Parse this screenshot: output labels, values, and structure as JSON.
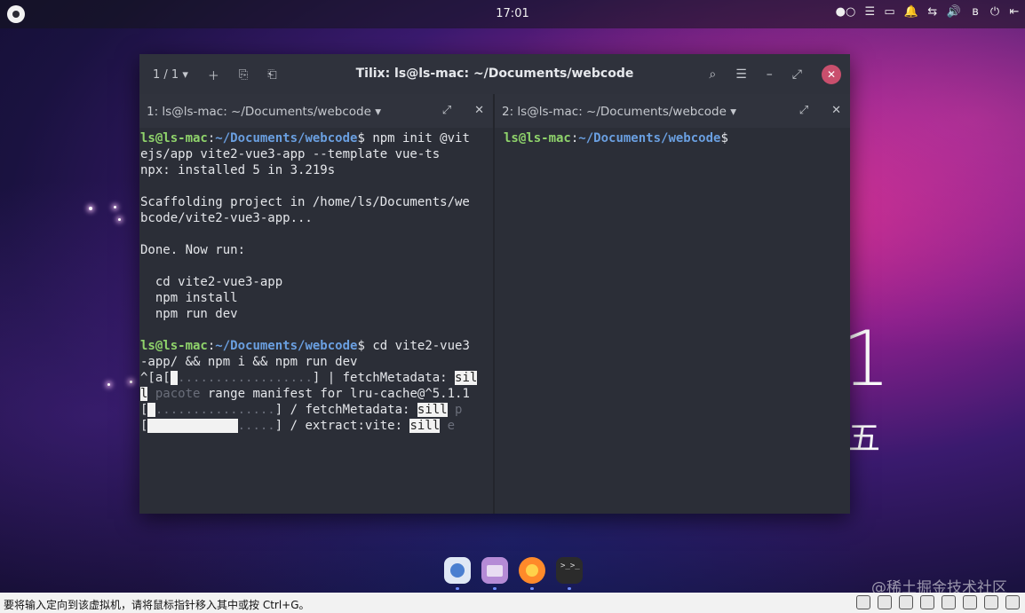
{
  "topbar": {
    "clock": "17:01",
    "tray": [
      "●○",
      "☰",
      "▭",
      "🔔",
      "⇆",
      "🔊",
      "ʙ",
      "⏻",
      "⇤"
    ]
  },
  "wallpaper": {
    "big_digit": "1",
    "weekday_char": "五"
  },
  "window": {
    "title": "Tilix: ls@ls-mac: ~/Documents/webcode",
    "session_counter": "1 / 1",
    "icons": {
      "session_dropdown": "chevron-down-icon",
      "add": "plus-icon",
      "add_right": "split-icon",
      "add_down": "split-down-icon",
      "search": "search-icon",
      "menu": "hamburger-icon",
      "minimize": "minimize-icon",
      "maximize": "maximize-icon",
      "close": "close-icon"
    }
  },
  "panes": [
    {
      "title": "1: ls@ls-mac: ~/Documents/webcode",
      "prompt_user": "ls@ls-mac",
      "prompt_path": "~/Documents/webcode"
    },
    {
      "title": "2: ls@ls-mac: ~/Documents/webcode",
      "prompt_user": "ls@ls-mac",
      "prompt_path": "~/Documents/webcode"
    }
  ],
  "terminal1": {
    "cmd1_a": " npm init @vit",
    "cmd1_b": "ejs/app vite2-vue3-app --template vue-ts",
    "l3": "npx: installed 5 in 3.219s",
    "l5": "Scaffolding project in /home/ls/Documents/we",
    "l6": "bcode/vite2-vue3-app...",
    "l8": "Done. Now run:",
    "l10": "  cd vite2-vue3-app",
    "l11": "  npm install",
    "l12": "  npm run dev",
    "cmd2_a": " cd vite2-vue3",
    "cmd2_b": "-app/ && npm i && npm run dev",
    "p1_a": "^[a[",
    "p1_dots": "..................",
    "p1_b": "] | fetchMetadata: ",
    "p1_hl": "sil",
    "p2_hl": "l",
    "p2_dim": " pacote",
    "p2_rest": " range manifest for lru-cache@^5.1.1",
    "p3_a": "[",
    "p3_dots": "................",
    "p3_b": "] / fetchMetadata: ",
    "p3_hl": "sill",
    "p3_dim": " p",
    "p4_a": "[",
    "p4_dots": ".....",
    "p4_b": "] / extract:vite: ",
    "p4_hl": "sill",
    "p4_dim": " e"
  },
  "dock": {
    "items": [
      {
        "name": "launcher-icon",
        "color": "#dfe8f5"
      },
      {
        "name": "file-manager-icon",
        "color": "#b58bd6"
      },
      {
        "name": "firefox-icon",
        "color": "#ff8a2a"
      },
      {
        "name": "terminal-icon",
        "color": "#2b2b2b"
      }
    ]
  },
  "watermark": "@稀土掘金技术社区",
  "statusbar": {
    "message": "要将输入定向到该虚拟机，请将鼠标指针移入其中或按 Ctrl+G。"
  }
}
